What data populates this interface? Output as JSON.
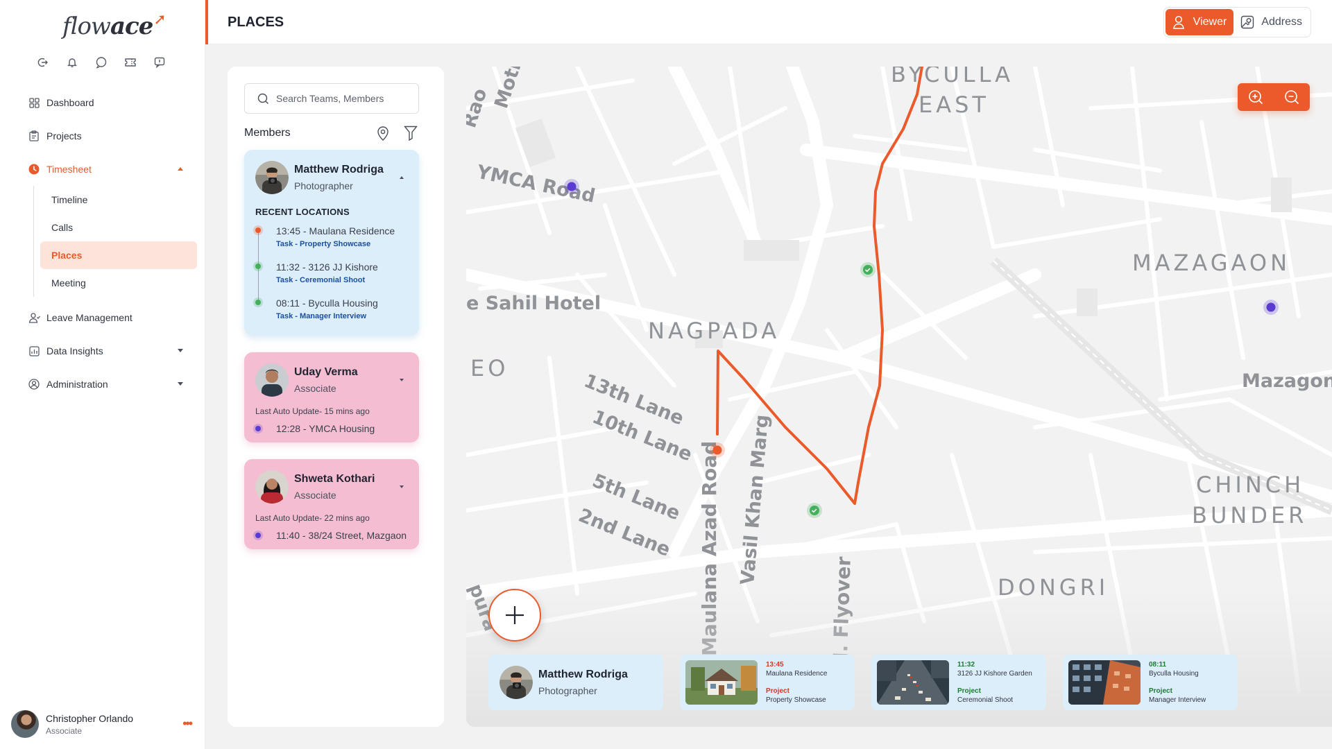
{
  "app": {
    "logo_text_light": "flow",
    "logo_text_bold": "ace",
    "page_title": "PLACES"
  },
  "colors": {
    "accent": "#ea5a2a",
    "card_blue": "#dceefa",
    "card_pink": "#f4bdd2",
    "route": "#ea5a2a",
    "marker_green": "#43b05c",
    "marker_purple": "#5a3bd1"
  },
  "quick_icons": [
    "logout-icon",
    "bell-icon",
    "chat-icon",
    "ticket-icon",
    "feedback-icon"
  ],
  "sidebar": {
    "items": [
      {
        "label": "Dashboard",
        "icon": "grid-icon"
      },
      {
        "label": "Projects",
        "icon": "clipboard-icon"
      },
      {
        "label": "Timesheet",
        "icon": "clock-icon",
        "active": true,
        "expanded": true
      },
      {
        "label": "Leave Management",
        "icon": "people-icon"
      },
      {
        "label": "Data Insights",
        "icon": "chart-icon"
      },
      {
        "label": "Administration",
        "icon": "admin-icon"
      }
    ],
    "timesheet_sub": [
      "Timeline",
      "Calls",
      "Places",
      "Meeting"
    ],
    "active_sub": "Places"
  },
  "user": {
    "name": "Christopher Orlando",
    "role": "Associate"
  },
  "header": {
    "view_toggle": [
      {
        "label": "Viewer",
        "active": true
      },
      {
        "label": "Address",
        "active": false
      }
    ]
  },
  "panel": {
    "search_placeholder": "Search Teams, Members",
    "members_label": "Members",
    "members": [
      {
        "name": "Matthew Rodriga",
        "role": "Photographer",
        "expanded": true,
        "recent_title": "RECENT LOCATIONS",
        "locations": [
          {
            "text": "13:45 - Maulana Residence",
            "task": "Task - Property Showcase"
          },
          {
            "text": "11:32 - 3126 JJ Kishore",
            "task": "Task - Ceremonial Shoot"
          },
          {
            "text": "08:11 - Byculla Housing",
            "task": "Task - Manager Interview"
          }
        ]
      },
      {
        "name": "Uday Verma",
        "role": "Associate",
        "auto_update": "Last Auto Update- 15 mins ago",
        "location": "12:28 - YMCA Housing"
      },
      {
        "name": "Shweta Kothari",
        "role": "Associate",
        "auto_update": "Last Auto Update- 22 mins ago",
        "location": "11:40 - 38/24 Street, Mazgaon"
      }
    ]
  },
  "map": {
    "labels": {
      "byculla": "BYCULLA",
      "east": "EAST",
      "mazagaon": "MAZAGAON",
      "mazagon": "Mazagon F",
      "nagpada": "NAGPADA",
      "sahil": "e Sahil Hotel",
      "eo": "EO",
      "ymca": "YMCA Road",
      "motil": "Motil",
      "rao": "Rao",
      "lane13": "13th Lane",
      "lane10": "10th Lane",
      "lane5": "5th Lane",
      "lane2": "2nd Lane",
      "azad": "Maulana Azad Road",
      "vasil": "Vasil Khan Marg",
      "flyover": "J.J. Flyover",
      "chinch": "CHINCH",
      "bunder": "BUNDER",
      "dongri": "DONGRI",
      "pura": "pura"
    },
    "selected_member": {
      "name": "Matthew Rodriga",
      "role": "Photographer"
    },
    "visits": [
      {
        "time": "13:45",
        "place": "Maulana Residence",
        "label": "Project",
        "project": "Property Showcase",
        "color": "#d23c1e",
        "thumb": "house-photo"
      },
      {
        "time": "11:32",
        "place": "3126 JJ Kishore Garden",
        "label": "Project",
        "project": "Ceremonial Shoot",
        "color": "#1f7a35",
        "thumb": "traffic-photo"
      },
      {
        "time": "08:11",
        "place": "Byculla Housing",
        "label": "Project",
        "project": "Manager Interview",
        "color": "#1f7a35",
        "thumb": "building-photo"
      }
    ]
  }
}
